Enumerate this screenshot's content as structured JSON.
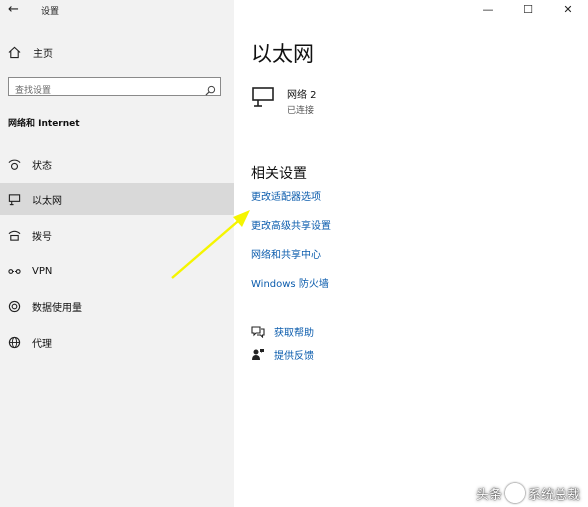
{
  "window": {
    "title": "设置"
  },
  "sidebar": {
    "home_label": "主页",
    "search_placeholder": "查找设置",
    "section_title": "网络和 Internet",
    "items": [
      {
        "label": "状态",
        "icon": "status-icon"
      },
      {
        "label": "以太网",
        "icon": "ethernet-icon"
      },
      {
        "label": "拨号",
        "icon": "dialup-icon"
      },
      {
        "label": "VPN",
        "icon": "vpn-icon"
      },
      {
        "label": "数据使用量",
        "icon": "data-usage-icon"
      },
      {
        "label": "代理",
        "icon": "proxy-icon"
      }
    ],
    "active_index": 1
  },
  "main": {
    "title": "以太网",
    "network": {
      "name": "网络 2",
      "status": "已连接"
    },
    "related_title": "相关设置",
    "links": [
      "更改适配器选项",
      "更改高级共享设置",
      "网络和共享中心",
      "Windows 防火墙"
    ],
    "help": [
      {
        "label": "获取帮助",
        "icon": "help-chat-icon"
      },
      {
        "label": "提供反馈",
        "icon": "feedback-icon"
      }
    ]
  },
  "watermark": {
    "text_left": "头条",
    "text_right": "系统总裁"
  },
  "colors": {
    "accent": "#0b5cad",
    "sidebar_bg": "#f2f2f2",
    "active_bg": "#d9d9d9",
    "arrow": "#f5f500"
  }
}
